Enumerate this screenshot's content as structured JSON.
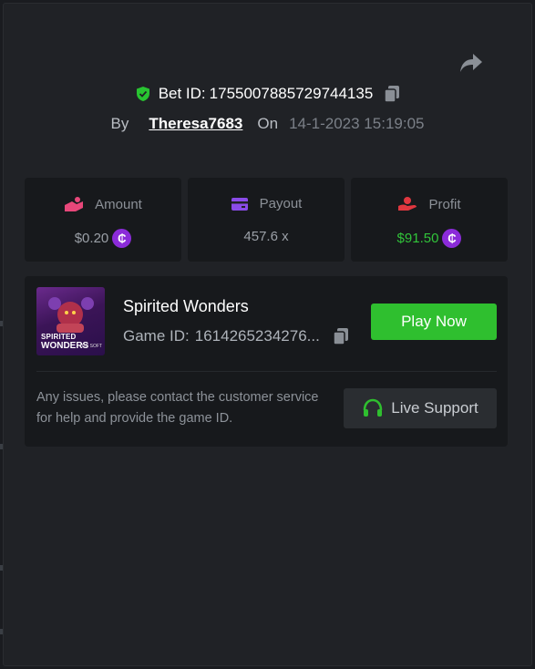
{
  "share": {
    "icon": "share-icon"
  },
  "bet": {
    "label": "Bet ID:",
    "id": "1755007885729744135",
    "icon": "shield-check-icon"
  },
  "meta": {
    "by_label": "By",
    "user": "Theresa7683",
    "on_label": "On",
    "datetime": "14-1-2023 15:19:05"
  },
  "stats": {
    "amount": {
      "label": "Amount",
      "value": "$0.20",
      "icon": "coins-hand-icon"
    },
    "payout": {
      "label": "Payout",
      "value": "457.6 x",
      "icon": "card-icon"
    },
    "profit": {
      "label": "Profit",
      "value": "$91.50",
      "icon": "hand-coin-icon"
    }
  },
  "coin_symbol": "₵",
  "game": {
    "title": "Spirited Wonders",
    "id_label": "Game ID:",
    "id_value": "1614265234276...",
    "play_label": "Play Now",
    "thumb_line1": "SPIRITED",
    "thumb_line2": "WONDERS",
    "thumb_brand": "PG SOFT"
  },
  "support": {
    "help_text": "Any issues, please contact the customer service for help and provide the game ID.",
    "button_label": "Live Support",
    "icon": "headset-icon"
  },
  "colors": {
    "accent_green": "#2fbf2f",
    "profit_green": "#31c43a",
    "coin_purple": "#8b2bd9",
    "icon_red": "#e0373f",
    "icon_pink": "#e8477a",
    "icon_violet": "#8a4be8"
  }
}
